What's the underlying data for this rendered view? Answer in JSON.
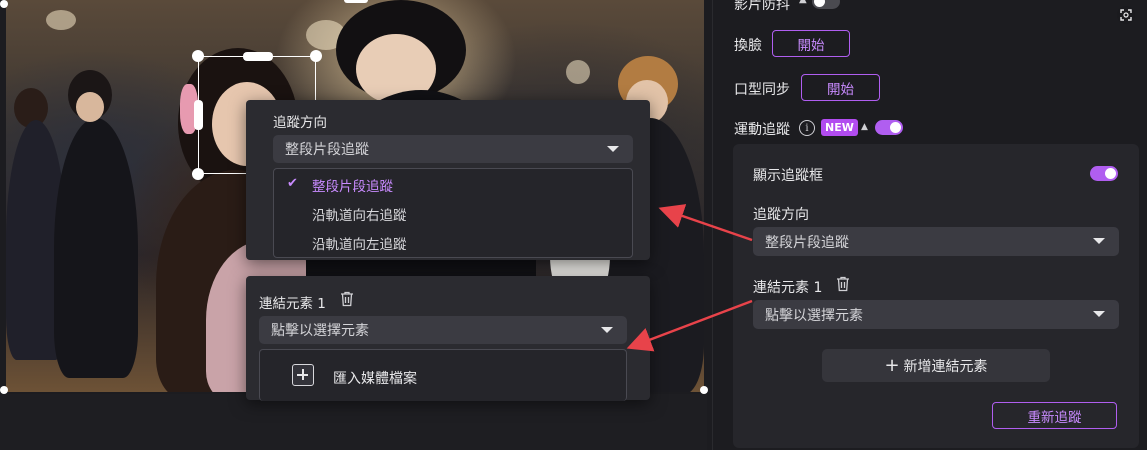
{
  "preview": {
    "popup_tracking": {
      "direction_label": "追蹤方向",
      "selected_value": "整段片段追蹤",
      "options": [
        "整段片段追蹤",
        "沿軌道向右追蹤",
        "沿軌道向左追蹤"
      ]
    },
    "popup_linked": {
      "linked_label": "連結元素 1",
      "select_placeholder": "點擊以選擇元素",
      "import_label": "匯入媒體檔案"
    }
  },
  "panel": {
    "stabilize_label": "影片防抖",
    "face_swap_label": "換臉",
    "face_swap_button": "開始",
    "lip_sync_label": "口型同步",
    "lip_sync_button": "開始",
    "motion_tracking_label": "運動追蹤",
    "new_badge": "NEW",
    "show_box_label": "顯示追蹤框",
    "direction_label": "追蹤方向",
    "direction_value": "整段片段追蹤",
    "linked_label": "連結元素 1",
    "linked_placeholder": "點擊以選擇元素",
    "add_linked_button": "新增連結元素",
    "retrack_button": "重新追蹤"
  },
  "colors": {
    "accent": "#b05ef0",
    "accent_text": "#c98bff",
    "arrow": "#e8434a"
  }
}
